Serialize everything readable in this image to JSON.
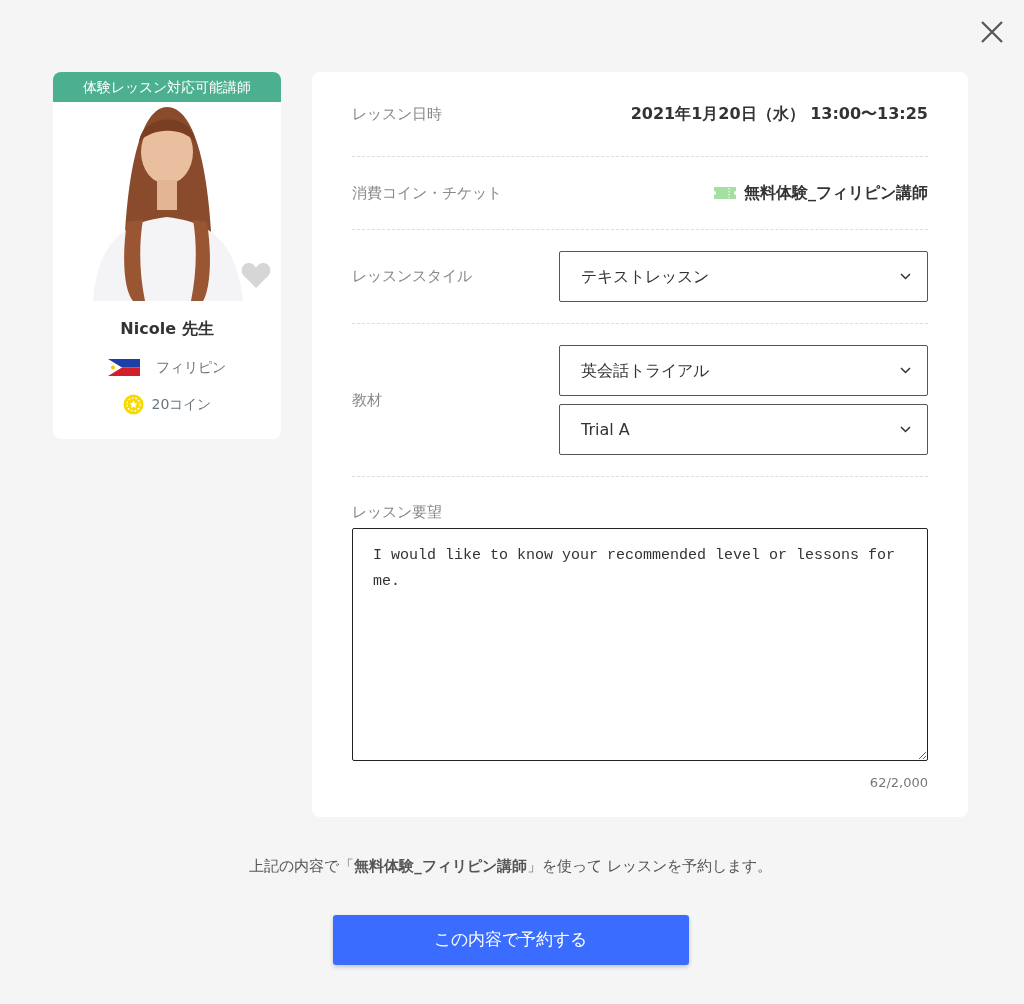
{
  "teacher": {
    "badge": "体験レッスン対応可能講師",
    "favorited": false,
    "name": "Nicole 先生",
    "country": "フィリピン",
    "coins": "20コイン"
  },
  "details": [
    {
      "kind": "text",
      "label": "レッスン日時",
      "value": "2021年1月20日（水） 13:00〜13:25"
    },
    {
      "kind": "ticket",
      "label": "消費コイン・チケット",
      "value": "無料体験_フィリピン講師"
    },
    {
      "kind": "select",
      "label": "レッスンスタイル",
      "selects": [
        "テキストレッスン"
      ]
    },
    {
      "kind": "select",
      "label": "教材",
      "selects": [
        "英会話トライアル",
        "Trial A"
      ]
    }
  ],
  "request": {
    "label": "レッスン要望",
    "value": "I would like to know your recommended level or lessons for me.",
    "counter": "62/2,000"
  },
  "notice": "上記の内容で「**無料体験_フィリピン講師**」を使って レッスンを予約します。",
  "submit": "この内容で予約する"
}
